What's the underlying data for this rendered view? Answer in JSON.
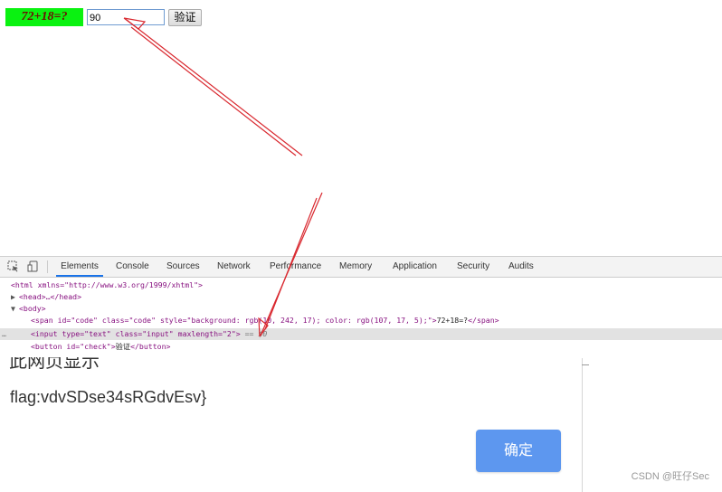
{
  "page": {
    "captcha_text": "72+18=?",
    "input_value": "90",
    "verify_label": "验证"
  },
  "devtools": {
    "tabs": [
      "Elements",
      "Console",
      "Sources",
      "Network",
      "Performance",
      "Memory",
      "Application",
      "Security",
      "Audits"
    ],
    "active_tab": "Elements",
    "dom": {
      "html_open": "<html xmlns=\"http://www.w3.org/1999/xhtml\">",
      "head": "<head>…</head>",
      "body_open": "<body>",
      "span_tag": "<span id=\"code\" class=\"code\" style=\"background: rgb(10, 242, 17); color: rgb(107, 17, 5);\">",
      "span_text": "72+18=?",
      "span_close": "</span>",
      "input_tag": "<input type=\"text\" class=\"input\" maxlength=\"2\">",
      "selected_marker": " == $0",
      "row_dots": "…",
      "button_open": "<button id=\"check\">",
      "button_text": "验证",
      "button_close": "</button>"
    }
  },
  "dialog": {
    "title_partial": "此网页显示",
    "flag": "flag:vdvSDse34sRGdvEsv}",
    "ok_label": "确定"
  },
  "watermark": "CSDN @旺仔Sec",
  "colors": {
    "captcha_bg": "#0af211",
    "captcha_text": "#6b1105",
    "annotation_arrow": "#d9282f",
    "ok_button": "#5d97ef"
  }
}
